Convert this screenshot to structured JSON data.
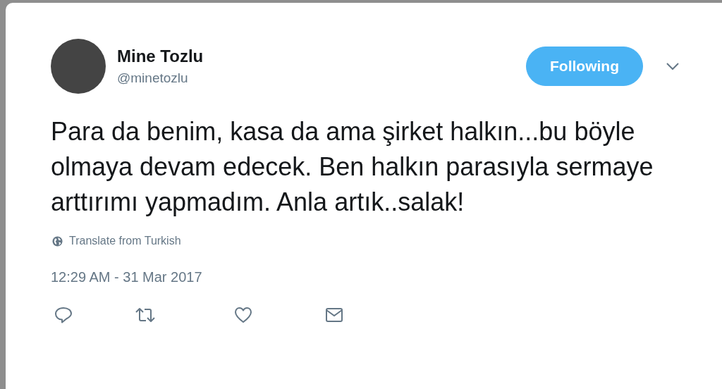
{
  "tweet": {
    "author": {
      "name": "Mine Tozlu",
      "handle": "@minetozlu"
    },
    "follow_button": {
      "label": "Following",
      "selected": true
    },
    "text": "Para da benim, kasa da ama şirket halkın...bu böyle olmaya devam edecek. Ben halkın parasıyla sermaye arttırımı yapmadım. Anla artık..salak!",
    "translate_link": "Translate from Turkish",
    "timestamp": "12:29 AM - 31 Mar 2017"
  }
}
